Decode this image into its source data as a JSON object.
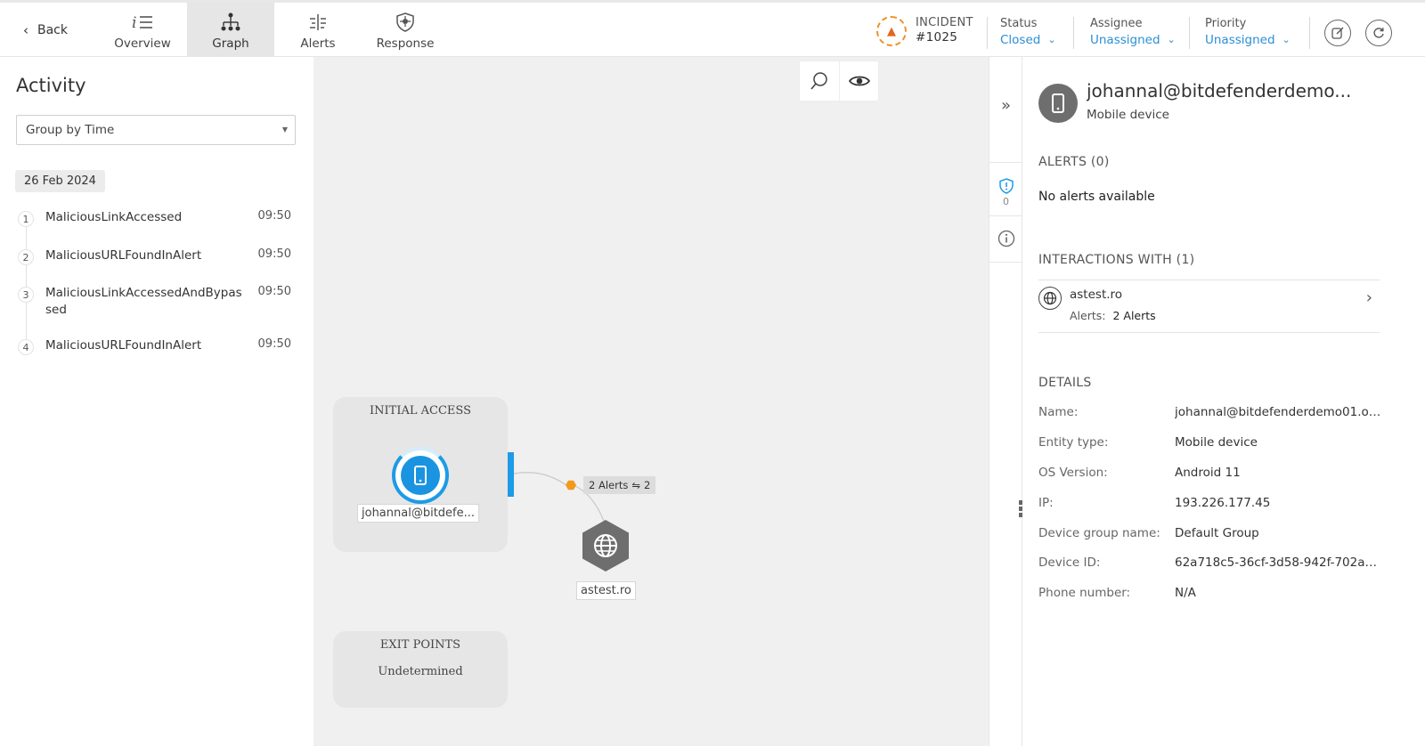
{
  "nav": {
    "back_label": "Back",
    "tabs": [
      {
        "label": "Overview",
        "icon": "list-icon"
      },
      {
        "label": "Graph",
        "icon": "graph-icon",
        "active": true
      },
      {
        "label": "Alerts",
        "icon": "alerts-icon"
      },
      {
        "label": "Response",
        "icon": "shield-icon"
      }
    ]
  },
  "incident": {
    "label": "INCIDENT",
    "number": "#1025",
    "icon": "flame-icon",
    "accent": "#f0912a"
  },
  "status": {
    "label": "Status",
    "value": "Closed"
  },
  "assignee": {
    "label": "Assignee",
    "value": "Unassigned"
  },
  "priority": {
    "label": "Priority",
    "value": "Unassigned"
  },
  "activity": {
    "title": "Activity",
    "group_by": "Group by Time",
    "date": "26 Feb 2024",
    "items": [
      {
        "index": "1",
        "name": "MaliciousLinkAccessed",
        "time": "09:50"
      },
      {
        "index": "2",
        "name": "MaliciousURLFoundInAlert",
        "time": "09:50"
      },
      {
        "index": "3",
        "name": "MaliciousLinkAccessedAndBypassed",
        "time": "09:50"
      },
      {
        "index": "4",
        "name": "MaliciousURLFoundInAlert",
        "time": "09:50"
      }
    ]
  },
  "graph": {
    "initial_access_title": "INITIAL ACCESS",
    "device_label": "johannal@bitdefe...",
    "edge_badge": "2 Alerts",
    "edge_count": "2",
    "domain_label": "astest.ro",
    "exit_title": "EXIT POINTS",
    "exit_value": "Undetermined",
    "accent": "#1d9be6"
  },
  "strip": {
    "alert_count": "0"
  },
  "detail": {
    "name": "johannal@bitdefenderdemo...",
    "type": "Mobile device",
    "alerts_title": "ALERTS (0)",
    "no_alerts": "No alerts available",
    "interactions_title": "INTERACTIONS WITH (1)",
    "interaction": {
      "name": "astest.ro",
      "alerts_label": "Alerts:",
      "alerts_value": "2 Alerts"
    },
    "details_title": "DETAILS",
    "rows": [
      {
        "key": "Name:",
        "value": "johannal@bitdefenderdemo01.on..."
      },
      {
        "key": "Entity type:",
        "value": "Mobile device"
      },
      {
        "key": "OS Version:",
        "value": "Android 11"
      },
      {
        "key": "IP:",
        "value": "193.226.177.45"
      },
      {
        "key": "Device group name:",
        "value": "Default Group"
      },
      {
        "key": "Device ID:",
        "value": "62a718c5-36cf-3d58-942f-702ab36..."
      },
      {
        "key": "Phone number:",
        "value": "N/A"
      }
    ]
  }
}
